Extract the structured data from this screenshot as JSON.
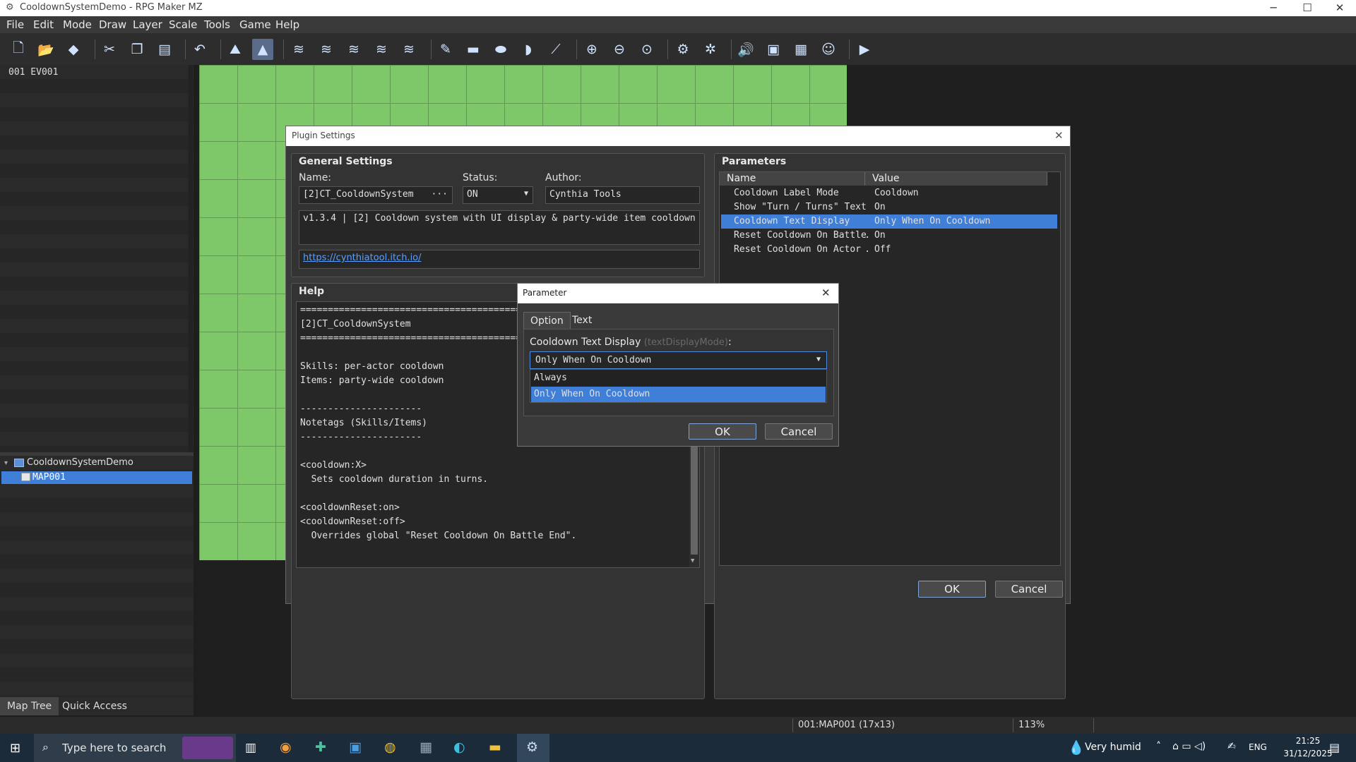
{
  "window": {
    "title": "CooldownSystemDemo - RPG Maker MZ",
    "controls": {
      "minimize": "─",
      "maximize": "☐",
      "close": "✕"
    }
  },
  "menu": [
    "File",
    "Edit",
    "Mode",
    "Draw",
    "Layer",
    "Scale",
    "Tools",
    "Game",
    "Help"
  ],
  "toolbar_icons": [
    "new-project-icon",
    "open-project-icon",
    "save-project-icon",
    "cut-icon",
    "copy-icon",
    "paste-icon",
    "undo-icon",
    "map-mode-icon",
    "event-mode-icon",
    "layer-1-icon",
    "layer-2-icon",
    "layer-3-icon",
    "layer-4-icon",
    "layer-all-icon",
    "pencil-icon",
    "rectangle-icon",
    "ellipse-icon",
    "flood-fill-icon",
    "shadow-pen-icon",
    "zoom-in-icon",
    "zoom-out-icon",
    "zoom-actual-icon",
    "database-icon",
    "plugin-manager-icon",
    "sound-test-icon",
    "event-searcher-icon",
    "resource-manager-icon",
    "character-generator-icon",
    "playtest-icon"
  ],
  "event_list": {
    "items": [
      "001 EV001"
    ]
  },
  "map_tree": {
    "project": "CooldownSystemDemo",
    "maps": [
      "MAP001"
    ]
  },
  "left_tabs": [
    "Map Tree",
    "Quick Access"
  ],
  "status_bar": {
    "map_info": "001:MAP001 (17x13)",
    "zoom": "113%"
  },
  "taskbar": {
    "search_placeholder": "Type here to search",
    "weather": "Very humid",
    "language": "ENG",
    "time": "21:25",
    "date": "31/12/2025"
  },
  "plugin_settings": {
    "title": "Plugin Settings",
    "general": {
      "heading": "General Settings",
      "name_label": "Name:",
      "name_value": "[2]CT_CooldownSystem",
      "name_more": "···",
      "status_label": "Status:",
      "status_value": "ON",
      "author_label": "Author:",
      "author_value": "Cynthia Tools",
      "description": "v1.3.4 | [2] Cooldown system with UI display & party-wide item cooldown",
      "url": "https://cynthiatool.itch.io/"
    },
    "help": {
      "heading": "Help",
      "lines": [
        "==================================================",
        "[2]CT_CooldownSystem",
        "==================================================",
        "",
        "Skills: per-actor cooldown",
        "Items: party-wide cooldown",
        "",
        "----------------------",
        "Notetags (Skills/Items)",
        "----------------------",
        "",
        "<cooldown:X>",
        "  Sets cooldown duration in turns.",
        "",
        "<cooldownReset:on>",
        "<cooldownReset:off>",
        "  Overrides global \"Reset Cooldown On Battle End\"."
      ]
    },
    "parameters": {
      "heading": "Parameters",
      "columns": [
        "Name",
        "Value"
      ],
      "rows": [
        {
          "name": "Cooldown Label Mode",
          "value": "Cooldown"
        },
        {
          "name": "Show \"Turn / Turns\" Text",
          "value": "On"
        },
        {
          "name": "Cooldown Text Display",
          "value": "Only When On Cooldown"
        },
        {
          "name": "Reset Cooldown On Battle…",
          "value": "On"
        },
        {
          "name": "Reset Cooldown On Actor …",
          "value": "Off"
        }
      ],
      "selected_index": 2
    },
    "ok_label": "OK",
    "cancel_label": "Cancel"
  },
  "parameter_dialog": {
    "title": "Parameter",
    "tabs": [
      "Option",
      "Text"
    ],
    "field_label": "Cooldown Text Display",
    "field_key": "(textDisplayMode)",
    "field_suffix": ":",
    "selected_value": "Only When On Cooldown",
    "options": [
      "Always",
      "Only When On Cooldown"
    ],
    "ok_label": "OK",
    "cancel_label": "Cancel"
  }
}
